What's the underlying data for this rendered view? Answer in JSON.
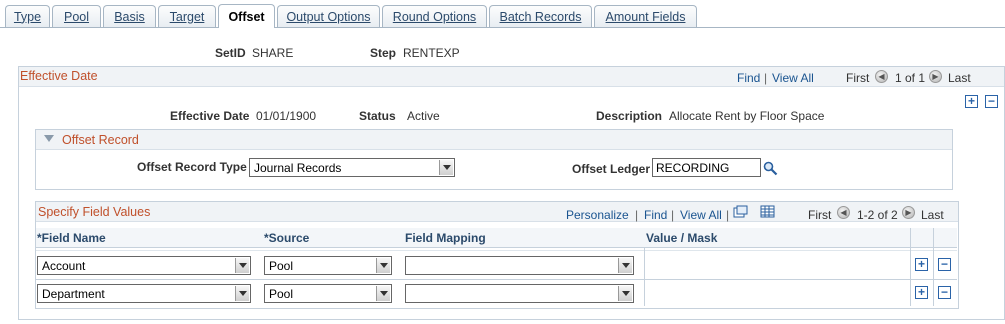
{
  "tabs": [
    {
      "label": "Type",
      "active": false
    },
    {
      "label": "Pool",
      "active": false
    },
    {
      "label": "Basis",
      "active": false
    },
    {
      "label": "Target",
      "active": false
    },
    {
      "label": "Offset",
      "active": true
    },
    {
      "label": "Output Options",
      "active": false
    },
    {
      "label": "Round Options",
      "active": false
    },
    {
      "label": "Batch Records",
      "active": false
    },
    {
      "label": "Amount Fields",
      "active": false
    }
  ],
  "header": {
    "setid_label": "SetID",
    "setid_value": "SHARE",
    "step_label": "Step",
    "step_value": "RENTEXP"
  },
  "effective_date_box": {
    "title": "Effective Date",
    "nav": {
      "find": "Find",
      "view_all": "View All",
      "first": "First",
      "range": "1 of 1",
      "last": "Last"
    },
    "effective_date_label": "Effective Date",
    "effective_date_value": "01/01/1900",
    "status_label": "Status",
    "status_value": "Active",
    "description_label": "Description",
    "description_value": "Allocate Rent by Floor Space"
  },
  "offset_record": {
    "title": "Offset Record",
    "type_label": "Offset Record Type",
    "type_value": "Journal Records",
    "ledger_label": "Offset Ledger",
    "ledger_value": "RECORDING"
  },
  "field_values": {
    "title": "Specify Field Values",
    "nav": {
      "personalize": "Personalize",
      "find": "Find",
      "view_all": "View All",
      "first": "First",
      "range": "1-2 of 2",
      "last": "Last"
    },
    "columns": {
      "field_name": "*Field Name",
      "source": "*Source",
      "field_mapping": "Field Mapping",
      "value_mask": "Value / Mask"
    },
    "rows": [
      {
        "field_name": "Account",
        "source": "Pool",
        "field_mapping": "",
        "value_mask": ""
      },
      {
        "field_name": "Department",
        "source": "Pool",
        "field_mapping": "",
        "value_mask": ""
      }
    ]
  },
  "icons": {
    "add": "+",
    "remove": "−",
    "prev": "◀",
    "next": "▶"
  }
}
